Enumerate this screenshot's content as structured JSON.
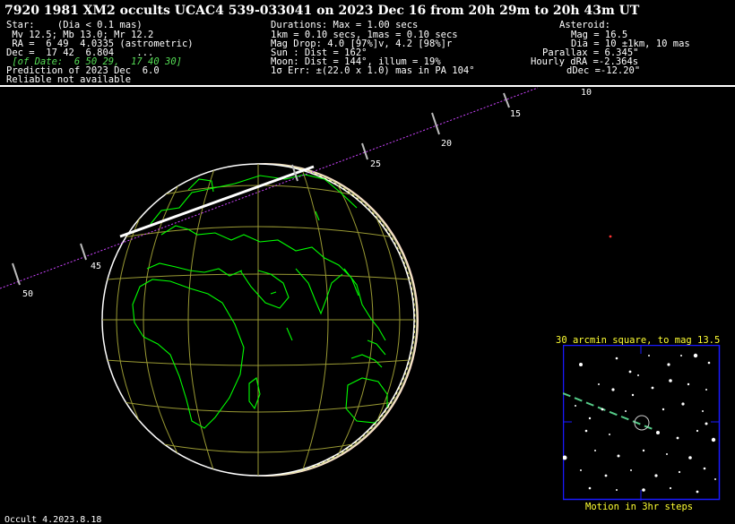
{
  "header": {
    "title": "7920 1981 XM2 occults UCAC4 539-033041 on 2023 Dec 16 from 20h 29m to 20h 43m UT"
  },
  "star": {
    "line1": "Star:    (Dia < 0.1 mas)",
    "line2": " Mv 12.5; Mb 13.0; Mr 12.2",
    "line3": " RA =  6 49  4.0335 (astrometric)",
    "line4": "Dec =  17 42  6.804    ...",
    "of_date": " [of Date:  6 50 29,  17 40 30]",
    "prediction": "Prediction of 2023 Dec  6.0",
    "reliable": "Reliable not available"
  },
  "durations": {
    "line1": "Durations: Max = 1.00 secs",
    "line2": "1km = 0.10 secs, 1mas = 0.10 secs",
    "line3": "Mag Drop: 4.0 [97%]v, 4.2 [98%]r",
    "line4": "Sun : Dist = 162°",
    "line5": "Moon: Dist = 144°, illum = 19%",
    "line6": "1σ Err: ±(22.0 x 1.0) mas in PA 104°"
  },
  "asteroid": {
    "line1": "Asteroid:",
    "line2": "Mag = 16.5",
    "line3": "Dia = 10 ±1km, 10 mas",
    "line4": "Parallax = 6.345\"",
    "line5": "Hourly dRA =-2.364s",
    "line6": "dDec =-12.20\""
  },
  "path_ticks": [
    "10",
    "15",
    "20",
    "25",
    "45",
    "50"
  ],
  "finder": {
    "title": "30 arcmin square, to mag 13.5",
    "footer": "Motion in 3hr steps"
  },
  "footer": {
    "version": "Occult 4.2023.8.18"
  },
  "colors": {
    "coast": "#00ff00",
    "grid": "#999933",
    "path": "#ff44ff",
    "finder_box": "#1a1aff",
    "yellow": "#ffff33"
  }
}
